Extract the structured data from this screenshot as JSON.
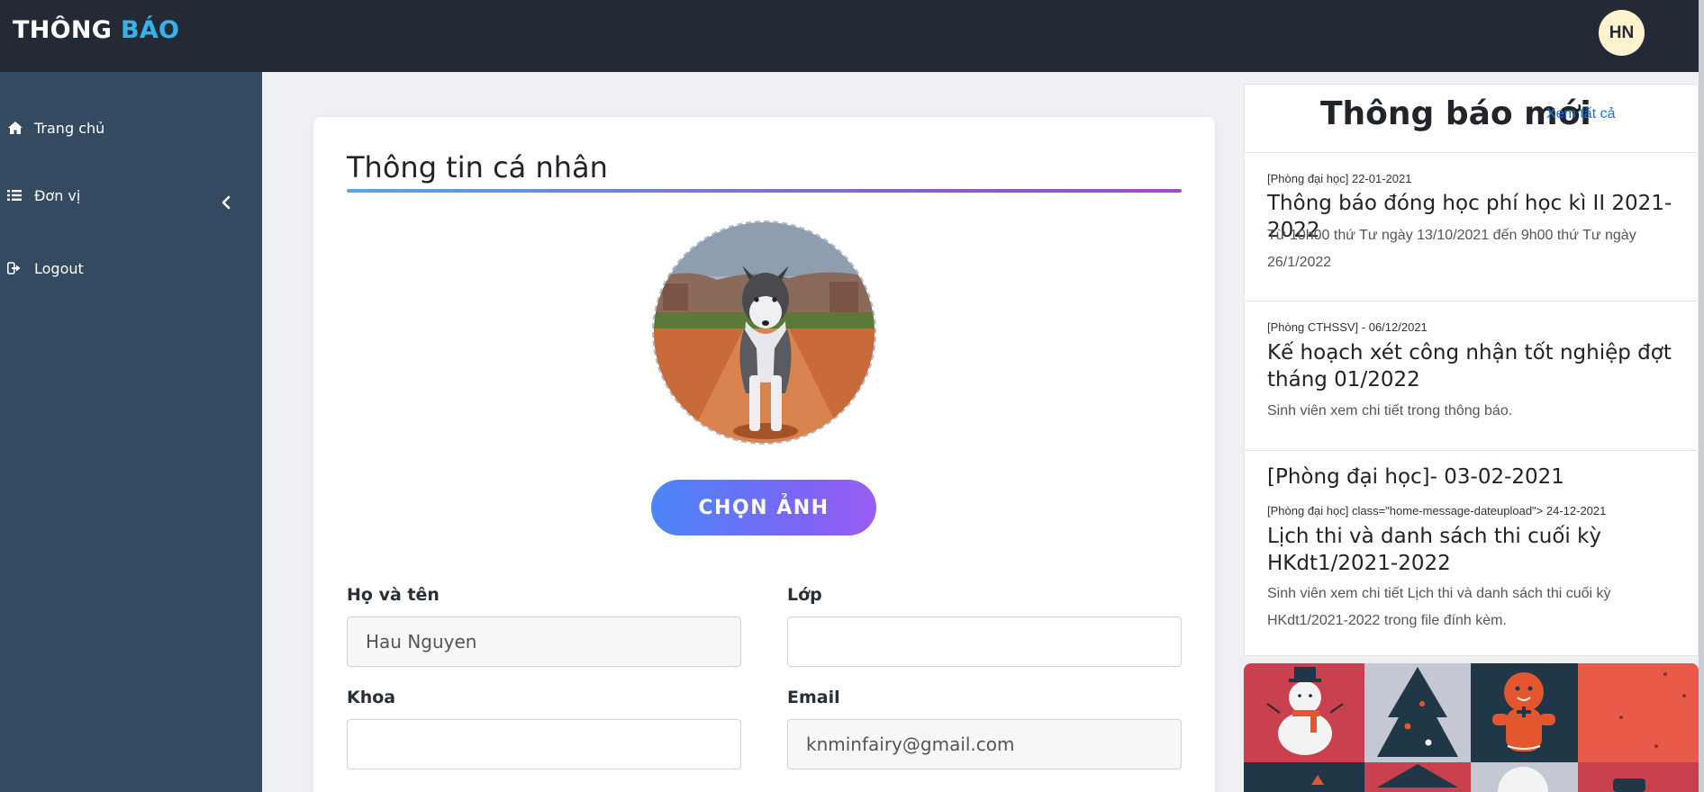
{
  "header": {
    "logo_main": "THÔNG ",
    "logo_accent": "BÁO",
    "user_initials": "HN"
  },
  "sidebar": {
    "items": [
      {
        "label": "Trang chủ",
        "icon": "home-icon"
      },
      {
        "label": "Đơn vị",
        "icon": "list-icon"
      },
      {
        "label": "Logout",
        "icon": "logout-icon"
      }
    ],
    "collapse_icon": "chevron-left-icon"
  },
  "profile": {
    "title": "Thông tin cá nhân",
    "choose_photo_label": "CHỌN ẢNH",
    "fields": {
      "fullname": {
        "label": "Họ và tên",
        "value": "Hau Nguyen"
      },
      "class": {
        "label": "Lớp",
        "value": ""
      },
      "faculty": {
        "label": "Khoa",
        "value": ""
      },
      "email": {
        "label": "Email",
        "value": "knminfairy@gmail.com"
      }
    }
  },
  "notifications": {
    "title": "Thông báo mới",
    "see_all": "Xem tất cả",
    "items": [
      {
        "date": "[Phòng đại học] 22-01-2021",
        "title": "Thông báo đóng học phí học kì II 2021-2022",
        "desc": "Từ 10h00 thứ Tư ngày 13/10/2021 đến 9h00 thứ Tư ngày 26/1/2022"
      },
      {
        "date": "[Phòng CTHSSV] - 06/12/2021",
        "title": "Kế hoạch xét công nhận tốt nghiệp đợt tháng 01/2022",
        "desc": "Sinh viên xem chi tiết trong thông báo."
      },
      {
        "sub": "[Phòng đại học]- 03-02-2021",
        "date": "[Phòng đại học] class=\"home-message-dateupload\"> 24-12-2021",
        "title": "Lịch thi và danh sách thi cuối kỳ HKdt1/2021-2022",
        "desc": "Sinh viên xem chi tiết Lịch thi và danh sách thi cuối kỳ HKdt1/2021-2022 trong file đính kèm."
      }
    ]
  },
  "colors": {
    "topbar": "#242a35",
    "sidebar": "#334a61",
    "logo_accent": "#35b4ec",
    "link": "#1a73e8",
    "button_start": "#4a86f7",
    "button_end": "#9b5cf2"
  }
}
